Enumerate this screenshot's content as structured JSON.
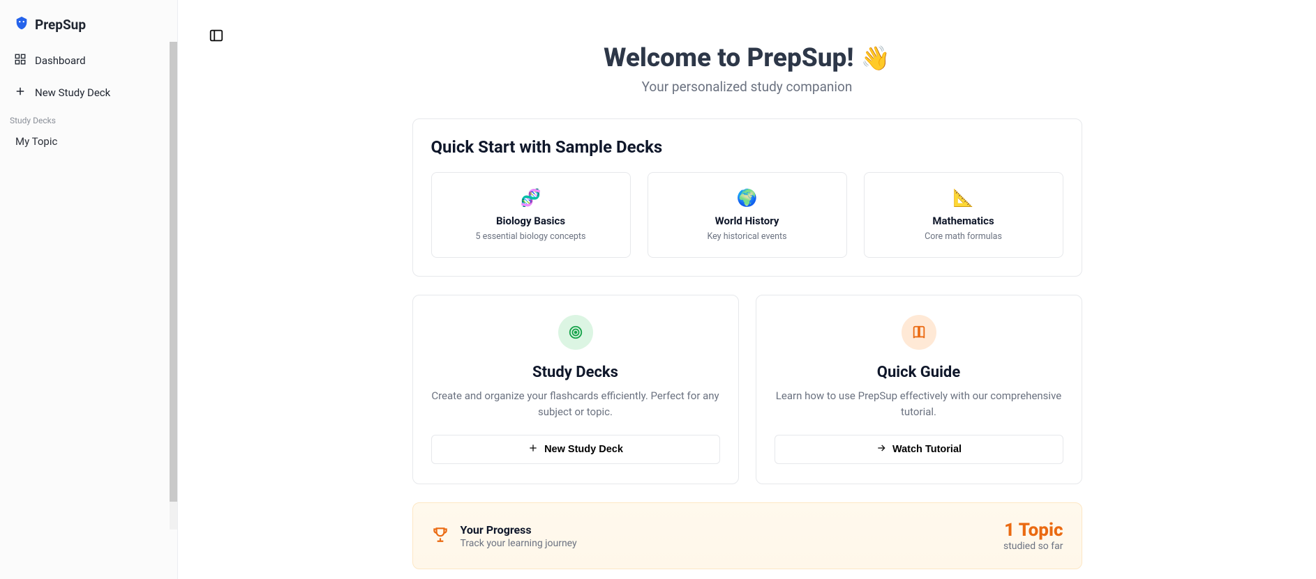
{
  "brand": "PrepSup",
  "sidebar": {
    "dashboard": "Dashboard",
    "new_deck": "New Study Deck",
    "section_label": "Study Decks",
    "topics": [
      "My Topic"
    ]
  },
  "hero": {
    "title": "Welcome to PrepSup!",
    "subtitle": "Your personalized study companion"
  },
  "quick_start": {
    "heading": "Quick Start with Sample Decks",
    "cards": [
      {
        "emoji": "🧬",
        "title": "Biology Basics",
        "desc": "5 essential biology concepts"
      },
      {
        "emoji": "🌍",
        "title": "World History",
        "desc": "Key historical events"
      },
      {
        "emoji": "📐",
        "title": "Mathematics",
        "desc": "Core math formulas"
      }
    ]
  },
  "panels": {
    "study": {
      "title": "Study Decks",
      "desc": "Create and organize your flashcards efficiently. Perfect for any subject or topic.",
      "button": "New Study Deck"
    },
    "guide": {
      "title": "Quick Guide",
      "desc": "Learn how to use PrepSup effectively with our comprehensive tutorial.",
      "button": "Watch Tutorial"
    }
  },
  "progress": {
    "title": "Your Progress",
    "subtitle": "Track your learning journey",
    "count": "1 Topic",
    "so_far": "studied so far"
  }
}
